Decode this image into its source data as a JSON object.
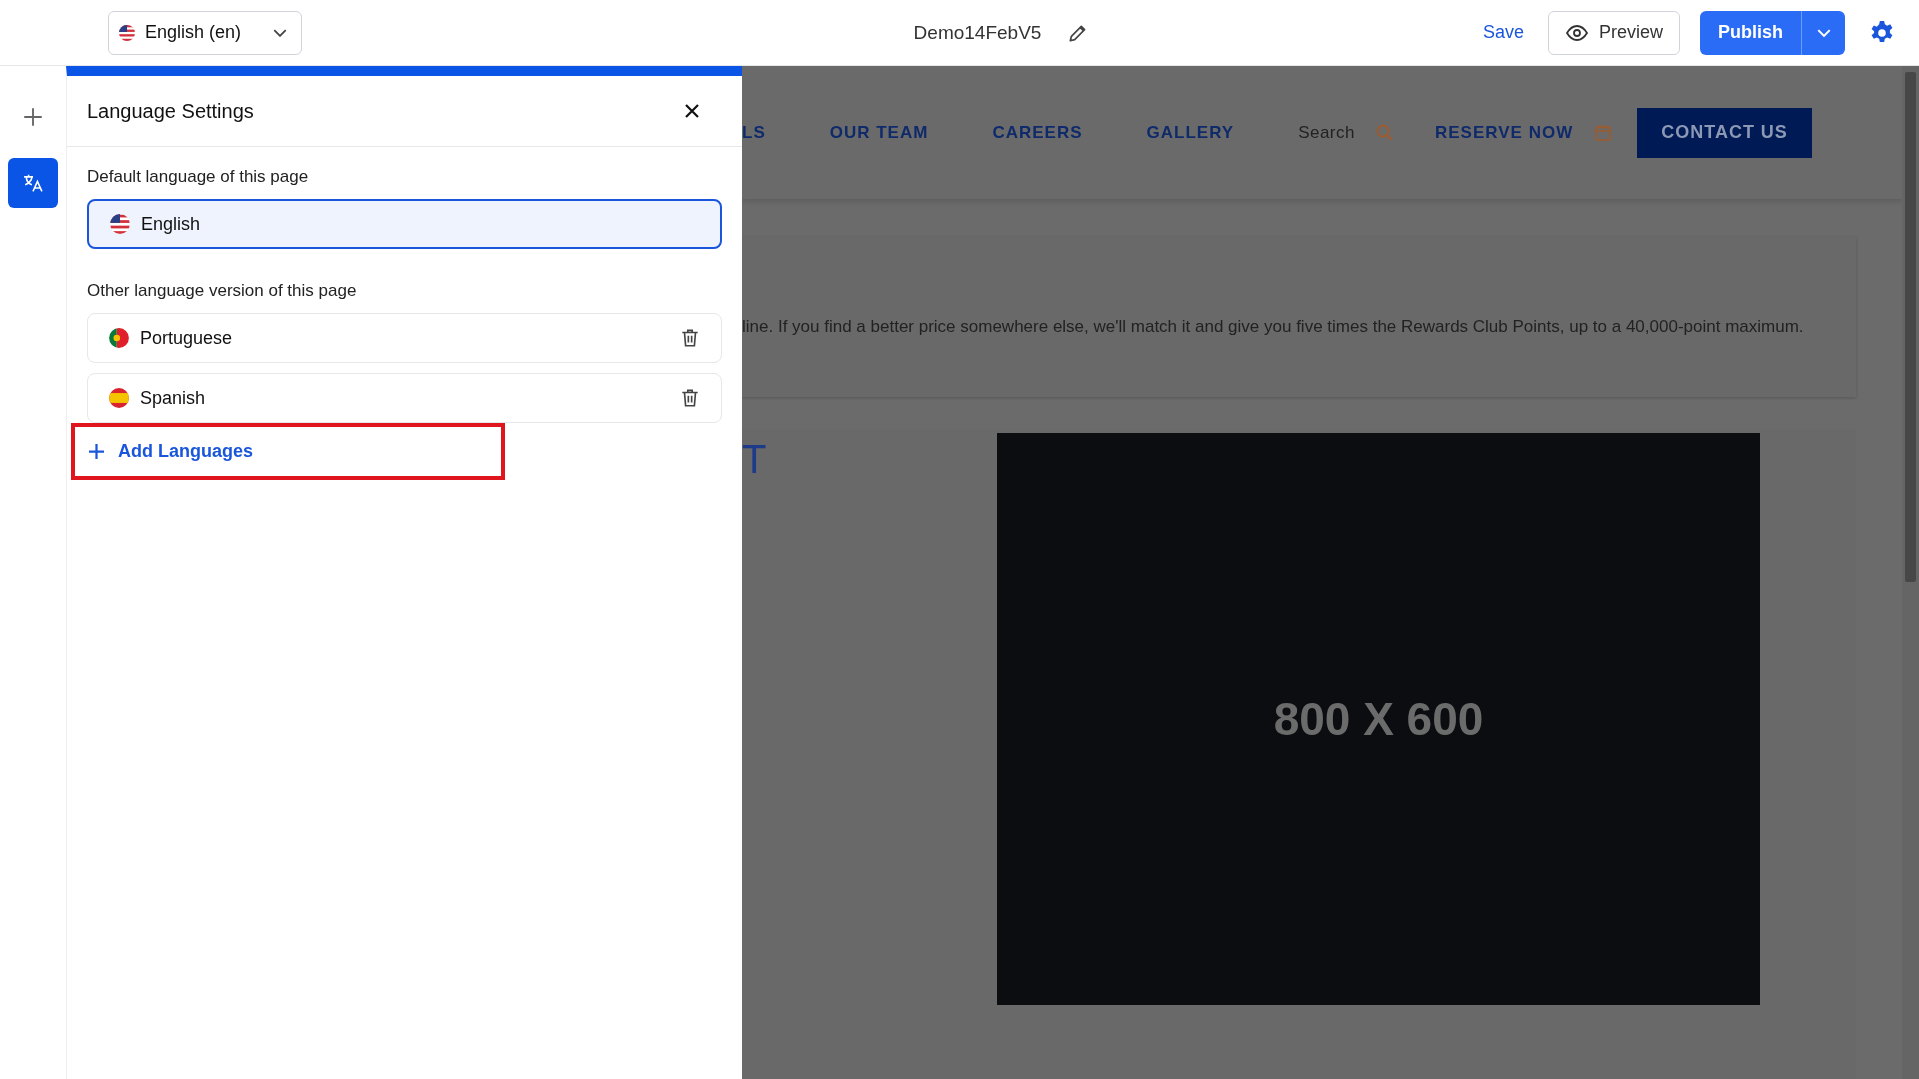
{
  "top_bar": {
    "language_selector": {
      "label": "English (en)"
    },
    "page_title": "Demo14FebV5",
    "actions": [
      {
        "kind": "link",
        "label": "Save"
      },
      {
        "kind": "outline",
        "label": "Preview"
      },
      {
        "kind": "split",
        "label": "Publish"
      }
    ]
  },
  "rail": [
    {
      "kind": "add",
      "selected": false
    },
    {
      "kind": "translate",
      "selected": true
    }
  ],
  "panel": {
    "title": "Language Settings",
    "default_label": "Default language of this page",
    "default_language": {
      "name": "English"
    },
    "other_label": "Other language version of this page",
    "other_languages": [
      {
        "name": "Portuguese",
        "kind": "pt"
      },
      {
        "name": "Spanish",
        "kind": "es"
      }
    ],
    "add_button": "Add Languages",
    "highlighted": true
  },
  "page": {
    "nav": [
      {
        "kind": "link",
        "label": "LS"
      },
      {
        "kind": "link",
        "label": "OUR TEAM"
      },
      {
        "kind": "link",
        "label": "CAREERS"
      },
      {
        "kind": "link",
        "label": "GALLERY"
      },
      {
        "kind": "search",
        "label": "Search"
      },
      {
        "kind": "reserve",
        "label": "RESERVE NOW"
      },
      {
        "kind": "cta",
        "label": "CONTACT US"
      }
    ],
    "paragraph": "line. If you find a better price somewhere else, we'll match it and give you five times the Rewards Club Points, up to a 40,000-point maximum.",
    "heading_fragment": "T",
    "placeholder_image": "800 X 600"
  }
}
